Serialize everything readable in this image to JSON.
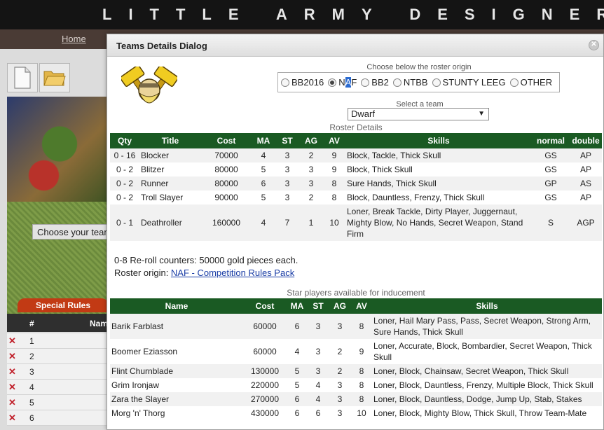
{
  "app": {
    "title": "LITTLE ARMY DESIGNER",
    "nav_home": "Home",
    "choose_team": "Choose your team",
    "special_rules": "Special Rules",
    "bg_table": {
      "col_hash": "#",
      "col_name": "Name",
      "rows": [
        "1",
        "2",
        "3",
        "4",
        "5",
        "6"
      ]
    }
  },
  "dialog": {
    "title": "Teams Details Dialog",
    "origin_label": "Choose below the roster origin",
    "origins": [
      {
        "label": "BB2016",
        "checked": false
      },
      {
        "label": "NAF",
        "checked": true
      },
      {
        "label": "BB2",
        "checked": false
      },
      {
        "label": "NTBB",
        "checked": false
      },
      {
        "label": "STUNTY LEEG",
        "checked": false
      },
      {
        "label": "OTHER",
        "checked": false
      }
    ],
    "team_label": "Select a team",
    "team_value": "Dwarf",
    "roster_caption": "Roster Details",
    "roster_headers": [
      "Qty",
      "Title",
      "Cost",
      "MA",
      "ST",
      "AG",
      "AV",
      "Skills",
      "normal",
      "double"
    ],
    "roster_rows": [
      {
        "qty": "0 - 16",
        "title": "Blocker",
        "cost": "70000",
        "ma": "4",
        "st": "3",
        "ag": "2",
        "av": "9",
        "skills": "Block, Tackle, Thick Skull",
        "normal": "GS",
        "double": "AP"
      },
      {
        "qty": "0 - 2",
        "title": "Blitzer",
        "cost": "80000",
        "ma": "5",
        "st": "3",
        "ag": "3",
        "av": "9",
        "skills": "Block, Thick Skull",
        "normal": "GS",
        "double": "AP"
      },
      {
        "qty": "0 - 2",
        "title": "Runner",
        "cost": "80000",
        "ma": "6",
        "st": "3",
        "ag": "3",
        "av": "8",
        "skills": "Sure Hands, Thick Skull",
        "normal": "GP",
        "double": "AS"
      },
      {
        "qty": "0 - 2",
        "title": "Troll Slayer",
        "cost": "90000",
        "ma": "5",
        "st": "3",
        "ag": "2",
        "av": "8",
        "skills": "Block, Dauntless, Frenzy, Thick Skull",
        "normal": "GS",
        "double": "AP"
      },
      {
        "qty": "0 - 1",
        "title": "Deathroller",
        "cost": "160000",
        "ma": "4",
        "st": "7",
        "ag": "1",
        "av": "10",
        "skills": "Loner, Break Tackle, Dirty Player, Juggernaut, Mighty Blow, No Hands, Secret Weapon, Stand Firm",
        "normal": "S",
        "double": "AGP"
      }
    ],
    "rerolls": "0-8 Re-roll counters: 50000 gold pieces each.",
    "origin_text": "Roster origin: ",
    "origin_link": "NAF - Competition Rules Pack",
    "star_caption": "Star players available for inducement",
    "star_headers": [
      "Name",
      "Cost",
      "MA",
      "ST",
      "AG",
      "AV",
      "Skills"
    ],
    "star_rows": [
      {
        "name": "Barik Farblast",
        "cost": "60000",
        "ma": "6",
        "st": "3",
        "ag": "3",
        "av": "8",
        "skills": "Loner, Hail Mary Pass, Pass, Secret Weapon, Strong Arm, Sure Hands, Thick Skull"
      },
      {
        "name": "Boomer Eziasson",
        "cost": "60000",
        "ma": "4",
        "st": "3",
        "ag": "2",
        "av": "9",
        "skills": "Loner, Accurate, Block, Bombardier, Secret Weapon, Thick Skull"
      },
      {
        "name": "Flint Churnblade",
        "cost": "130000",
        "ma": "5",
        "st": "3",
        "ag": "2",
        "av": "8",
        "skills": "Loner, Block, Chainsaw, Secret Weapon, Thick Skull"
      },
      {
        "name": "Grim Ironjaw",
        "cost": "220000",
        "ma": "5",
        "st": "4",
        "ag": "3",
        "av": "8",
        "skills": "Loner, Block, Dauntless, Frenzy, Multiple Block, Thick Skull"
      },
      {
        "name": "Zara the Slayer",
        "cost": "270000",
        "ma": "6",
        "st": "4",
        "ag": "3",
        "av": "8",
        "skills": "Loner, Block, Dauntless, Dodge, Jump Up, Stab, Stakes"
      },
      {
        "name": "Morg 'n' Thorg",
        "cost": "430000",
        "ma": "6",
        "st": "6",
        "ag": "3",
        "av": "10",
        "skills": "Loner, Block, Mighty Blow, Thick Skull, Throw Team-Mate"
      }
    ]
  },
  "colors": {
    "table_header": "#1a5a23",
    "special_rules": "#c23a14",
    "link": "#1a3da6"
  },
  "icons": [
    "new-file-icon",
    "open-folder-icon",
    "close-icon",
    "dwarf-team-logo",
    "delete-icon"
  ]
}
